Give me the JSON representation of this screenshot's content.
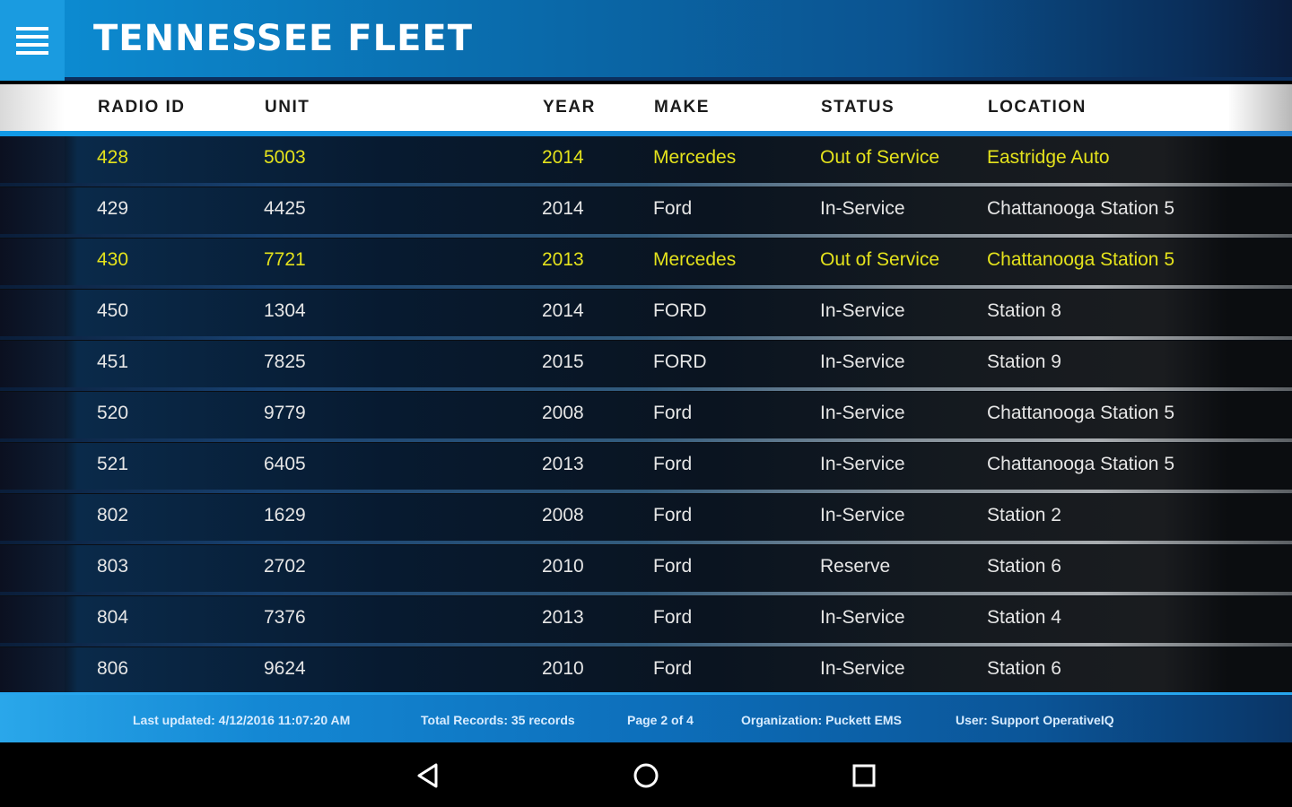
{
  "header": {
    "title": "TENNESSEE FLEET",
    "menu_icon": "hamburger-menu-icon"
  },
  "columns": [
    "RADIO ID",
    "UNIT",
    "YEAR",
    "MAKE",
    "STATUS",
    "LOCATION"
  ],
  "rows": [
    {
      "radio_id": "428",
      "unit": "5003",
      "year": "2014",
      "make": "Mercedes",
      "status": "Out of Service",
      "location": "Eastridge Auto",
      "highlight": true
    },
    {
      "radio_id": "429",
      "unit": "4425",
      "year": "2014",
      "make": "Ford",
      "status": "In-Service",
      "location": "Chattanooga Station 5",
      "highlight": false
    },
    {
      "radio_id": "430",
      "unit": "7721",
      "year": "2013",
      "make": "Mercedes",
      "status": "Out of Service",
      "location": "Chattanooga Station 5",
      "highlight": true
    },
    {
      "radio_id": "450",
      "unit": "1304",
      "year": "2014",
      "make": "FORD",
      "status": "In-Service",
      "location": "Station 8",
      "highlight": false
    },
    {
      "radio_id": "451",
      "unit": "7825",
      "year": "2015",
      "make": "FORD",
      "status": "In-Service",
      "location": "Station 9",
      "highlight": false
    },
    {
      "radio_id": "520",
      "unit": "9779",
      "year": "2008",
      "make": "Ford",
      "status": "In-Service",
      "location": "Chattanooga Station 5",
      "highlight": false
    },
    {
      "radio_id": "521",
      "unit": "6405",
      "year": "2013",
      "make": "Ford",
      "status": "In-Service",
      "location": "Chattanooga Station 5",
      "highlight": false
    },
    {
      "radio_id": "802",
      "unit": "1629",
      "year": "2008",
      "make": "Ford",
      "status": "In-Service",
      "location": "Station 2",
      "highlight": false
    },
    {
      "radio_id": "803",
      "unit": "2702",
      "year": "2010",
      "make": "Ford",
      "status": "Reserve",
      "location": "Station 6",
      "highlight": false
    },
    {
      "radio_id": "804",
      "unit": "7376",
      "year": "2013",
      "make": "Ford",
      "status": "In-Service",
      "location": "Station 4",
      "highlight": false
    },
    {
      "radio_id": "806",
      "unit": "9624",
      "year": "2010",
      "make": "Ford",
      "status": "In-Service",
      "location": "Station 6",
      "highlight": false
    }
  ],
  "footer": {
    "last_updated": "Last updated: 4/12/2016 11:07:20 AM",
    "total_records": "Total Records: 35 records",
    "page": "Page 2 of 4",
    "organization": "Organization: Puckett EMS",
    "user": "User: Support OperativeIQ"
  },
  "navbar": {
    "back_icon": "back-triangle-icon",
    "home_icon": "home-circle-icon",
    "recents_icon": "recents-square-icon"
  },
  "colors": {
    "highlight": "#e4e21c",
    "header_accent": "#1a9be0"
  }
}
